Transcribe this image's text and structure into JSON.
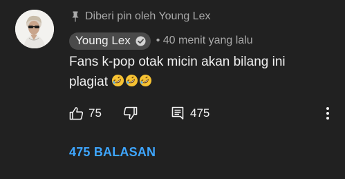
{
  "pinned_text": "Diberi pin oleh Young Lex",
  "author": {
    "name": "Young Lex",
    "verified": true
  },
  "timestamp": "• 40 menit yang lalu",
  "comment": {
    "line1": "Fans k-pop otak micin akan bilang ini",
    "line2": "plagiat",
    "emojis": [
      "rolling-on-floor-laughing",
      "rolling-on-floor-laughing",
      "rolling-on-floor-laughing"
    ]
  },
  "actions": {
    "like_count": "75",
    "reply_count": "475"
  },
  "view_replies_label": "475 BALASAN",
  "colors": {
    "background": "#212121",
    "link": "#3ea6ff",
    "secondary_text": "#aaaaaa",
    "author_chip": "#4a4a4a"
  }
}
